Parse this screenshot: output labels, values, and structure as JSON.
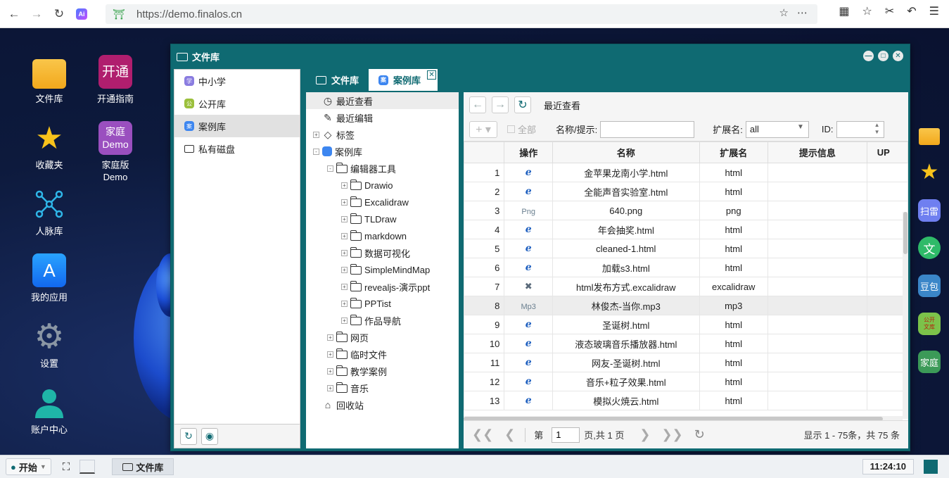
{
  "browser": {
    "url": "https://demo.finalos.cn",
    "icons": [
      "back-icon",
      "forward-icon",
      "reload-icon",
      "ai-icon",
      "shield-icon",
      "star-icon",
      "more-icon",
      "apps-icon",
      "favorites-icon",
      "cut-icon",
      "undo-icon",
      "menu-icon"
    ]
  },
  "desktop": {
    "icons": [
      {
        "label": "文件库",
        "icon": "folder-icon"
      },
      {
        "label": "开通指南",
        "icon": "kaitong-icon",
        "glyph": "开通"
      },
      {
        "label": "收藏夹",
        "icon": "star-icon"
      },
      {
        "label": "家庭版\nDemo",
        "icon": "family-demo-icon",
        "glyph": "家庭\nDemo"
      },
      {
        "label": "人脉库",
        "icon": "network-icon"
      },
      {
        "label": "我的应用",
        "icon": "app-store-icon"
      },
      {
        "label": "设置",
        "icon": "gear-icon"
      },
      {
        "label": "账户中心",
        "icon": "user-icon"
      }
    ],
    "dock": [
      {
        "icon": "folder-icon",
        "text": ""
      },
      {
        "icon": "star-icon",
        "text": ""
      },
      {
        "icon": "xunlei-icon",
        "text": "扫雷"
      },
      {
        "icon": "wen-icon",
        "text": "文"
      },
      {
        "icon": "doubao-icon",
        "text": "豆包"
      },
      {
        "icon": "public-lib-icon",
        "text": "公开\n文库"
      },
      {
        "icon": "family-icon",
        "text": "家庭"
      }
    ]
  },
  "window": {
    "title": "文件库",
    "left_nav": [
      {
        "label": "中小学",
        "badge": "学",
        "color": "#8a7ce0"
      },
      {
        "label": "公开库",
        "badge": "公",
        "color": "#9bc03c"
      },
      {
        "label": "案例库",
        "badge": "案",
        "color": "#3d86f0",
        "selected": true
      },
      {
        "label": "私有磁盘",
        "badge": "",
        "color": ""
      }
    ],
    "tabs": [
      {
        "label": "文件库",
        "active": false
      },
      {
        "label": "案例库",
        "active": true
      }
    ],
    "tree": [
      {
        "label": "最近查看",
        "level": 0,
        "icon": "clock-icon",
        "selected": true
      },
      {
        "label": "最近编辑",
        "level": 0,
        "icon": "edit-icon"
      },
      {
        "label": "标签",
        "level": 0,
        "icon": "tag-icon",
        "expander": "+"
      },
      {
        "label": "案例库",
        "level": 0,
        "icon": "lib-icon",
        "expander": "-"
      },
      {
        "label": "编辑器工具",
        "level": 1,
        "icon": "folder",
        "expander": "-"
      },
      {
        "label": "Drawio",
        "level": 2,
        "icon": "folder",
        "expander": "+"
      },
      {
        "label": "Excalidraw",
        "level": 2,
        "icon": "folder",
        "expander": "+"
      },
      {
        "label": "TLDraw",
        "level": 2,
        "icon": "folder",
        "expander": "+"
      },
      {
        "label": "markdown",
        "level": 2,
        "icon": "folder",
        "expander": "+"
      },
      {
        "label": "数据可视化",
        "level": 2,
        "icon": "folder",
        "expander": "+"
      },
      {
        "label": "SimpleMindMap",
        "level": 2,
        "icon": "folder",
        "expander": "+"
      },
      {
        "label": "revealjs-演示ppt",
        "level": 2,
        "icon": "folder",
        "expander": "+"
      },
      {
        "label": "PPTist",
        "level": 2,
        "icon": "folder",
        "expander": "+"
      },
      {
        "label": "作品导航",
        "level": 2,
        "icon": "folder",
        "expander": "+"
      },
      {
        "label": "网页",
        "level": 1,
        "icon": "folder",
        "expander": "+"
      },
      {
        "label": "临时文件",
        "level": 1,
        "icon": "folder",
        "expander": "+"
      },
      {
        "label": "教学案例",
        "level": 1,
        "icon": "folder",
        "expander": "+"
      },
      {
        "label": "音乐",
        "level": 1,
        "icon": "folder",
        "expander": "+"
      },
      {
        "label": "回收站",
        "level": 0,
        "icon": "trash-icon"
      }
    ],
    "toolbar": {
      "path": "最近查看",
      "select_all": "全部",
      "name_label": "名称/提示:",
      "name_value": "",
      "ext_label": "扩展名:",
      "ext_value": "all",
      "id_label": "ID:",
      "id_value": ""
    },
    "columns": [
      "操作",
      "名称",
      "扩展名",
      "提示信息",
      "UP"
    ],
    "rows": [
      {
        "n": "1",
        "type": "e",
        "name": "金苹果龙南小学.html",
        "ext": "html",
        "hint": ""
      },
      {
        "n": "2",
        "type": "e",
        "name": "全能声音实验室.html",
        "ext": "html",
        "hint": ""
      },
      {
        "n": "3",
        "type": "Png",
        "name": "640.png",
        "ext": "png",
        "hint": ""
      },
      {
        "n": "4",
        "type": "e",
        "name": "年会抽奖.html",
        "ext": "html",
        "hint": ""
      },
      {
        "n": "5",
        "type": "e",
        "name": "cleaned-1.html",
        "ext": "html",
        "hint": ""
      },
      {
        "n": "6",
        "type": "e",
        "name": "加载s3.html",
        "ext": "html",
        "hint": ""
      },
      {
        "n": "7",
        "type": "x",
        "name": "html发布方式.excalidraw",
        "ext": "excalidraw",
        "hint": ""
      },
      {
        "n": "8",
        "type": "Mp3",
        "name": "林俊杰-当你.mp3",
        "ext": "mp3",
        "hint": "",
        "highlight": true
      },
      {
        "n": "9",
        "type": "e",
        "name": "圣诞树.html",
        "ext": "html",
        "hint": ""
      },
      {
        "n": "10",
        "type": "e",
        "name": "液态玻璃音乐播放器.html",
        "ext": "html",
        "hint": ""
      },
      {
        "n": "11",
        "type": "e",
        "name": "网友-圣诞树.html",
        "ext": "html",
        "hint": ""
      },
      {
        "n": "12",
        "type": "e",
        "name": "音乐+粒子效果.html",
        "ext": "html",
        "hint": ""
      },
      {
        "n": "13",
        "type": "e",
        "name": "模拟火焼云.html",
        "ext": "html",
        "hint": ""
      }
    ],
    "pager": {
      "page_prefix": "第",
      "page_value": "1",
      "page_suffix": "页,共 1 页",
      "summary": "显示 1 - 75条，共 75 条"
    }
  },
  "taskbar": {
    "start": "开始",
    "task": "文件库",
    "time": "11:24:10"
  }
}
